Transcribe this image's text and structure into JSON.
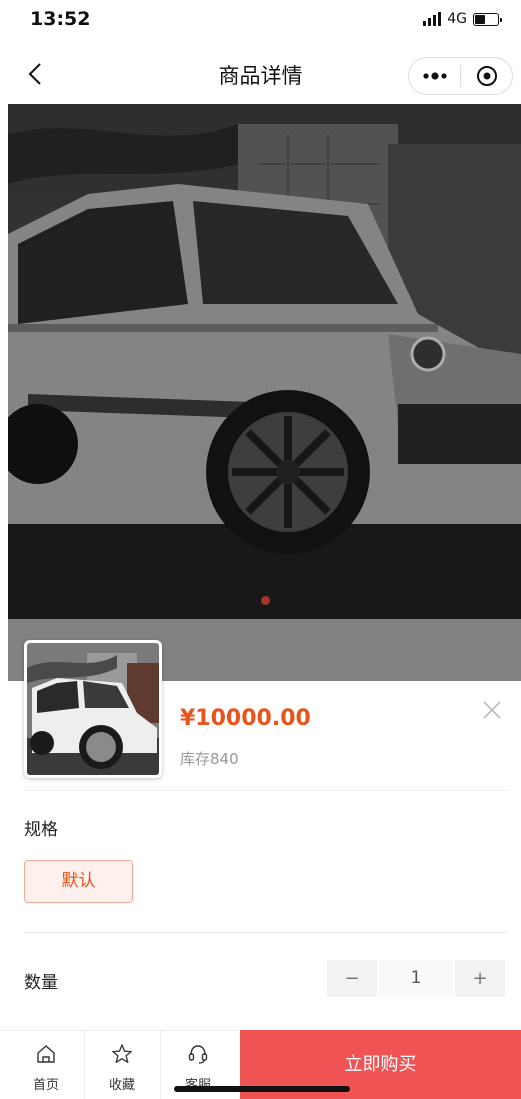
{
  "status_bar": {
    "time": "13:52",
    "network": "4G"
  },
  "nav": {
    "title": "商品详情",
    "more_glyph": "•••"
  },
  "product": {
    "price": "¥10000.00",
    "stock": "库存840"
  },
  "spec": {
    "label": "规格",
    "options": [
      "默认"
    ],
    "selected": "默认"
  },
  "quantity": {
    "label": "数量",
    "minus": "−",
    "value": "1",
    "plus": "+"
  },
  "tabbar": {
    "items": [
      {
        "label": "首页",
        "icon": "home-icon"
      },
      {
        "label": "收藏",
        "icon": "star-icon"
      },
      {
        "label": "客服",
        "icon": "headset-icon"
      }
    ],
    "buy_label": "立即购买"
  },
  "colors": {
    "accent": "#e8541e",
    "buy": "#f05353",
    "spec_bg": "#fdf0ed"
  }
}
